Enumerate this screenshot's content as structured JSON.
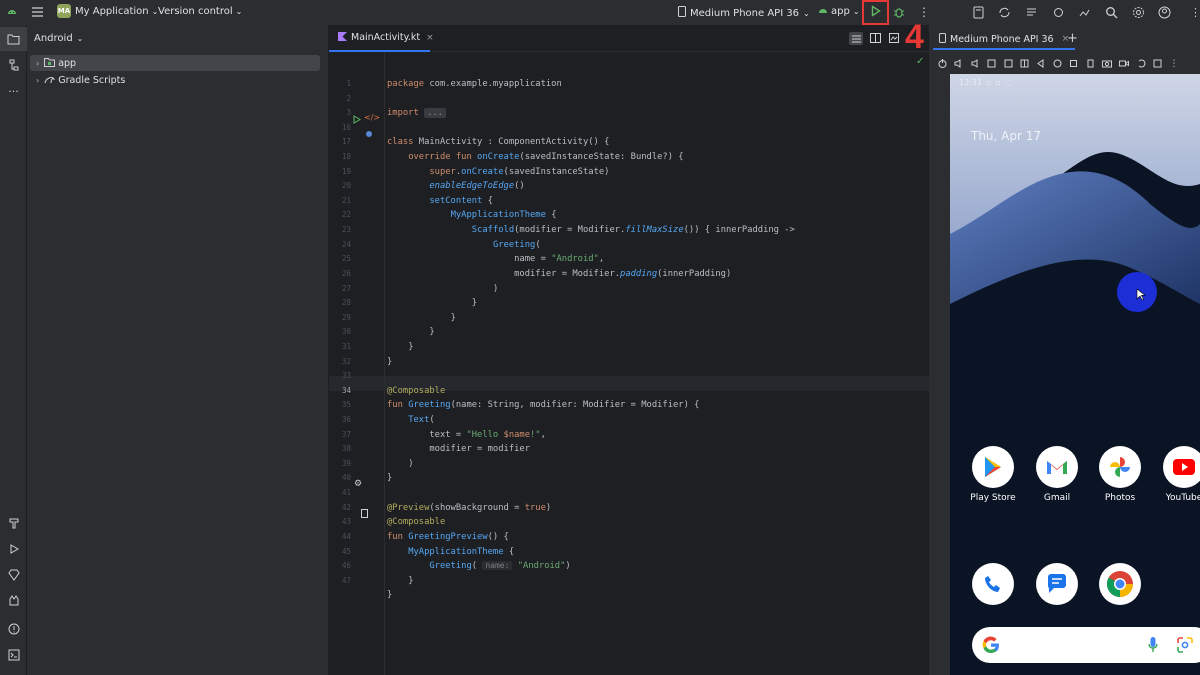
{
  "titlebar": {
    "project_badge": "MA",
    "project_name": "My Application",
    "vcs": "Version control",
    "device": "Medium Phone API 36",
    "run_config": "app",
    "step_label": "4"
  },
  "project_panel": {
    "view": "Android",
    "items": [
      {
        "label": "app"
      },
      {
        "label": "Gradle Scripts"
      }
    ]
  },
  "editor": {
    "tab": "MainActivity.kt",
    "line_numbers": [
      "1",
      "2",
      "3",
      "16",
      "17",
      "18",
      "19",
      "20",
      "21",
      "22",
      "23",
      "24",
      "25",
      "26",
      "27",
      "28",
      "29",
      "30",
      "31",
      "32",
      "33",
      "34",
      "35",
      "36",
      "37",
      "38",
      "39",
      "40",
      "41",
      "42",
      "43",
      "44",
      "45",
      "46",
      "47"
    ],
    "lines": [
      [
        [
          "kw",
          "package "
        ],
        [
          "pu",
          "com.example.myapplication"
        ]
      ],
      [],
      [
        [
          "kw",
          "import "
        ],
        [
          "fold",
          "..."
        ]
      ],
      [],
      [
        [
          "kw",
          "class "
        ],
        [
          "pu",
          "MainActivity : ComponentActivity() {"
        ]
      ],
      [
        [
          "sp",
          "    "
        ],
        [
          "kw",
          "override fun "
        ],
        [
          "fn",
          "onCreate"
        ],
        [
          "pu",
          "(savedInstanceState: Bundle?) {"
        ]
      ],
      [
        [
          "sp",
          "        "
        ],
        [
          "kw",
          "super"
        ],
        [
          "pu",
          "."
        ],
        [
          "fn",
          "onCreate"
        ],
        [
          "pu",
          "(savedInstanceState)"
        ]
      ],
      [
        [
          "sp",
          "        "
        ],
        [
          "it",
          "enableEdgeToEdge"
        ],
        [
          "pu",
          "()"
        ]
      ],
      [
        [
          "sp",
          "        "
        ],
        [
          "fn",
          "setContent"
        ],
        [
          "pu",
          " {"
        ]
      ],
      [
        [
          "sp",
          "            "
        ],
        [
          "ann2",
          "MyApplicationTheme"
        ],
        [
          "pu",
          " {"
        ]
      ],
      [
        [
          "sp",
          "                "
        ],
        [
          "ann2",
          "Scaffold"
        ],
        [
          "pu",
          "(modifier = Modifier."
        ],
        [
          "it",
          "fillMaxSize"
        ],
        [
          "pu",
          "()) { innerPadding ->"
        ]
      ],
      [
        [
          "sp",
          "                    "
        ],
        [
          "ann2",
          "Greeting"
        ],
        [
          "pu",
          "("
        ]
      ],
      [
        [
          "sp",
          "                        "
        ],
        [
          "pu",
          "name = "
        ],
        [
          "str",
          "\"Android\""
        ],
        [
          "pu",
          ","
        ]
      ],
      [
        [
          "sp",
          "                        "
        ],
        [
          "pu",
          "modifier = Modifier."
        ],
        [
          "it",
          "padding"
        ],
        [
          "pu",
          "(innerPadding)"
        ]
      ],
      [
        [
          "sp",
          "                    "
        ],
        [
          "pu",
          ")"
        ]
      ],
      [
        [
          "sp",
          "                "
        ],
        [
          "pu",
          "}"
        ]
      ],
      [
        [
          "sp",
          "            "
        ],
        [
          "pu",
          "}"
        ]
      ],
      [
        [
          "sp",
          "        "
        ],
        [
          "pu",
          "}"
        ]
      ],
      [
        [
          "sp",
          "    "
        ],
        [
          "pu",
          "}"
        ]
      ],
      [
        [
          "pu",
          "}"
        ]
      ],
      [],
      [
        [
          "ann",
          "@Composable"
        ]
      ],
      [
        [
          "kw",
          "fun "
        ],
        [
          "fn",
          "Greeting"
        ],
        [
          "pu",
          "(name: String, modifier: Modifier = Modifier) {"
        ]
      ],
      [
        [
          "sp",
          "    "
        ],
        [
          "ann2",
          "Text"
        ],
        [
          "pu",
          "("
        ]
      ],
      [
        [
          "sp",
          "        "
        ],
        [
          "pu",
          "text = "
        ],
        [
          "str",
          "\"Hello "
        ],
        [
          "kw",
          "$name"
        ],
        [
          "str",
          "!\""
        ],
        [
          "pu",
          ","
        ]
      ],
      [
        [
          "sp",
          "        "
        ],
        [
          "pu",
          "modifier = modifier"
        ]
      ],
      [
        [
          "sp",
          "    "
        ],
        [
          "pu",
          ")"
        ]
      ],
      [
        [
          "pu",
          "}"
        ]
      ],
      [],
      [
        [
          "ann",
          "@Preview"
        ],
        [
          "pu",
          "(showBackground = "
        ],
        [
          "kw",
          "true"
        ],
        [
          "pu",
          ")"
        ]
      ],
      [
        [
          "ann",
          "@Composable"
        ]
      ],
      [
        [
          "kw",
          "fun "
        ],
        [
          "fn",
          "GreetingPreview"
        ],
        [
          "pu",
          "() {"
        ]
      ],
      [
        [
          "sp",
          "    "
        ],
        [
          "ann2",
          "MyApplicationTheme"
        ],
        [
          "pu",
          " {"
        ]
      ],
      [
        [
          "sp",
          "        "
        ],
        [
          "ann2",
          "Greeting"
        ],
        [
          "pu",
          "( "
        ],
        [
          "hint",
          "name:"
        ],
        [
          "str",
          " \"Android\""
        ],
        [
          "pu",
          ")"
        ]
      ],
      [
        [
          "sp",
          "    "
        ],
        [
          "pu",
          "}"
        ]
      ],
      [
        [
          "pu",
          "}"
        ]
      ]
    ]
  },
  "emulator": {
    "tab": "Medium Phone API 36",
    "status_time": "13:31",
    "date": "Thu, Apr 17",
    "apps_row1": [
      {
        "label": "Play Store",
        "icon": "play-store-icon"
      },
      {
        "label": "Gmail",
        "icon": "gmail-icon"
      },
      {
        "label": "Photos",
        "icon": "photos-icon"
      },
      {
        "label": "YouTube",
        "icon": "youtube-icon"
      }
    ],
    "apps_row2": [
      {
        "icon": "phone-icon"
      },
      {
        "icon": "messages-icon"
      },
      {
        "icon": "chrome-icon"
      }
    ]
  },
  "colors": {
    "accent_red": "#e53935",
    "run_green": "#5fb865"
  }
}
